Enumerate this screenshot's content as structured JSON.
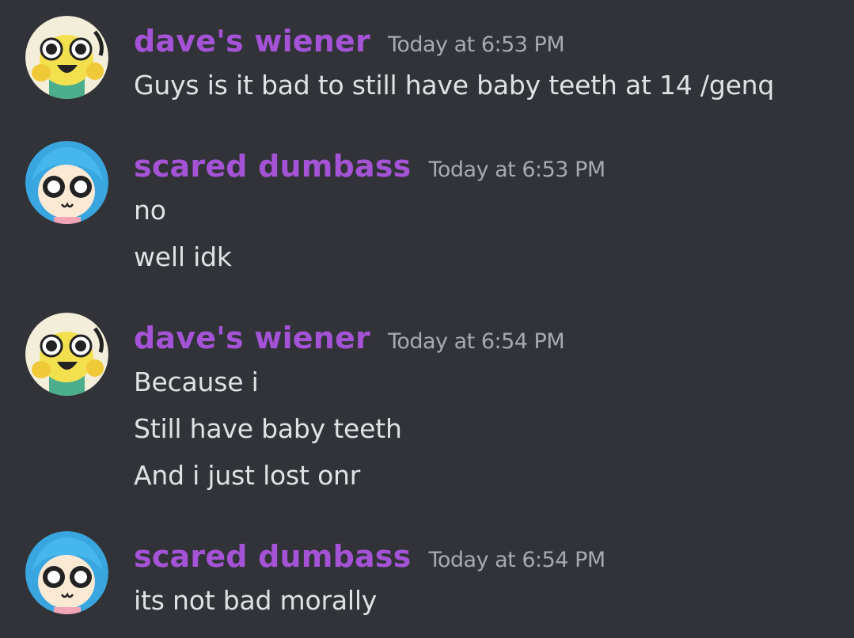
{
  "messages": [
    {
      "author": "dave's wiener",
      "timestamp": "Today at 6:53 PM",
      "avatar": "yellow-cartoon-face",
      "lines": [
        "Guys is it bad to still have baby teeth at 14 /genq"
      ]
    },
    {
      "author": "scared dumbass",
      "timestamp": "Today at 6:53 PM",
      "avatar": "blue-hair-cartoon-face",
      "lines": [
        "no",
        "well idk"
      ]
    },
    {
      "author": "dave's wiener",
      "timestamp": "Today at 6:54 PM",
      "avatar": "yellow-cartoon-face",
      "lines": [
        "Because i",
        "Still have baby teeth",
        "And i just lost onr"
      ]
    },
    {
      "author": "scared dumbass",
      "timestamp": "Today at 6:54 PM",
      "avatar": "blue-hair-cartoon-face",
      "lines": [
        "its not bad morally"
      ]
    }
  ],
  "colors": {
    "background": "#313338",
    "username": "#a553d6",
    "timestamp": "#a7aab0",
    "message_text": "#dfe1e5"
  }
}
